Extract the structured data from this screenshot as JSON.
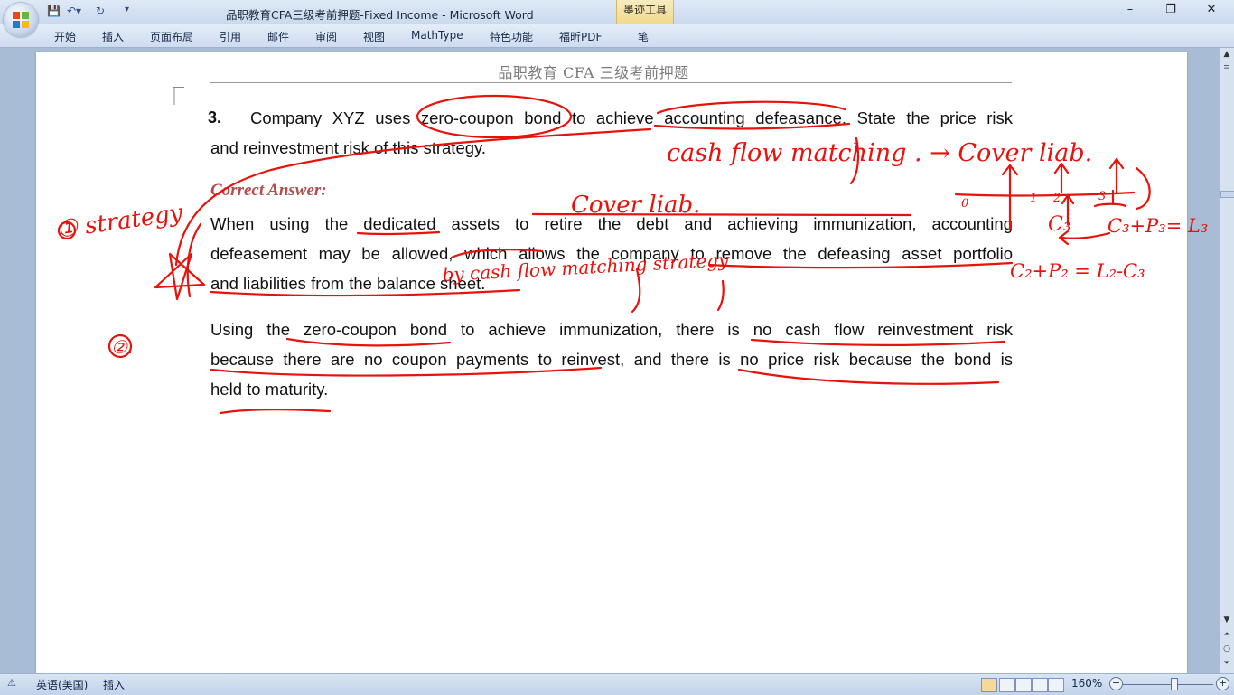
{
  "window": {
    "title": "品职教育CFA三级考前押题-Fixed Income - Microsoft Word",
    "contextual_tab": "墨迹工具",
    "controls": {
      "minimize": "–",
      "restore": "❐",
      "close": "✕"
    }
  },
  "ribbon": {
    "tabs": [
      "开始",
      "插入",
      "页面布局",
      "引用",
      "邮件",
      "审阅",
      "视图",
      "MathType",
      "特色功能",
      "福昕PDF",
      "笔"
    ],
    "help": "?"
  },
  "document": {
    "header": "品职教育 CFA 三级考前押题",
    "question_number": "3.",
    "question_lines": [
      "Company XYZ uses zero-coupon bond to achieve accounting defeasance. State the price risk",
      "and reinvestment  risk of this strategy."
    ],
    "answer_heading": "Correct Answer:",
    "paragraph1": [
      "When  using  the  dedicated  assets  to  retire  the  debt  and  achieving  immunization,  accounting",
      "defeasement may be allowed, which allows the company to remove the defeasing asset portfolio",
      "and liabilities from the balance sheet."
    ],
    "paragraph2": [
      "Using  the  zero-coupon  bond  to  achieve  immunization,  there  is  no  cash  flow  reinvestment  risk",
      "because there are no coupon payments to reinvest, and there is no price risk because the bond is",
      "held to maturity."
    ]
  },
  "annotations": {
    "note_top": "cash flow matching . → Cover liab.",
    "note_cover": "Cover liab.",
    "note_strategy_1": "① strategy",
    "note_strategy_2": "by cash flow matching strategy",
    "note_point_2": "②.",
    "timeline_ticks": [
      "0",
      "1",
      "2",
      "3"
    ],
    "eq1": "C₃",
    "eq2": "C₃+P₃= L₃",
    "eq3": "C₂+P₂ = L₂-C₃",
    "ink_color": "#e8120c"
  },
  "status_bar": {
    "language": "英语(美国)",
    "mode": "插入",
    "zoom": "160%"
  }
}
